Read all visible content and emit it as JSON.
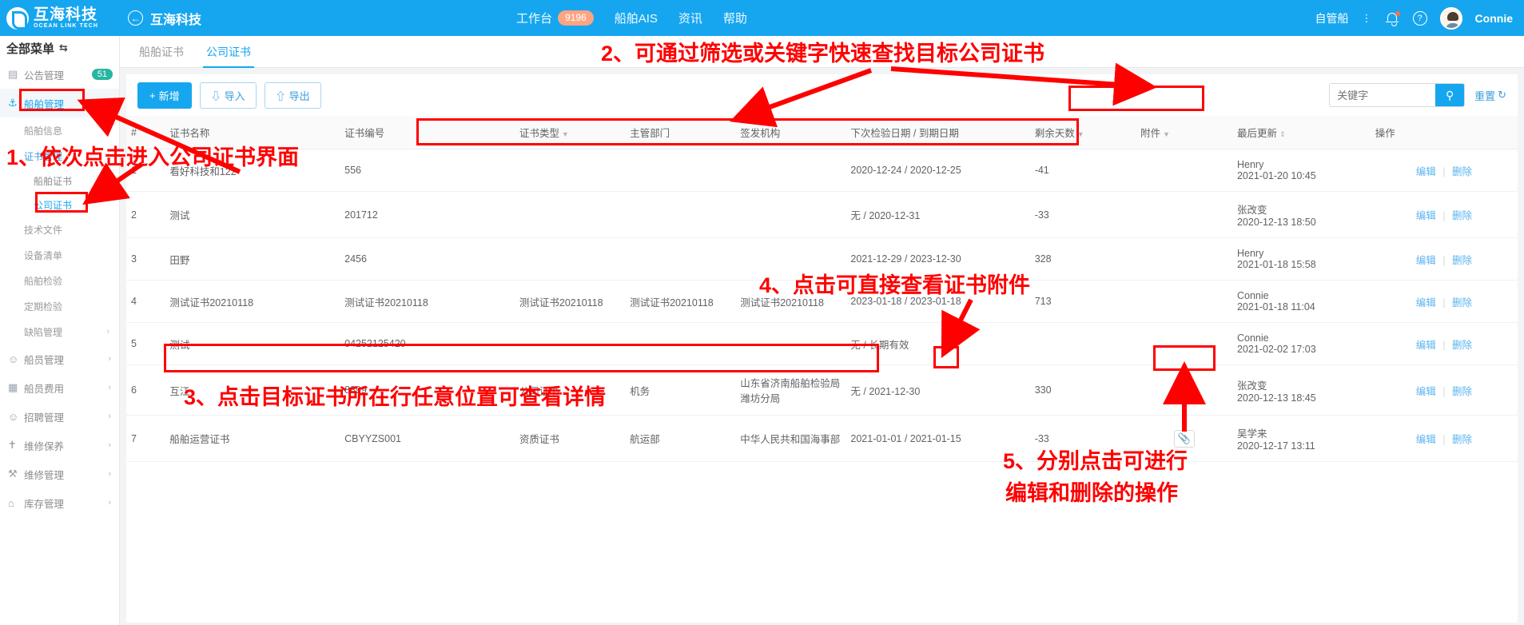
{
  "header": {
    "logo_cn": "互海科技",
    "logo_en": "OCEAN LINK TECH",
    "back_icon": "arrow-left-icon",
    "back_title": "互海科技",
    "nav": [
      {
        "label": "工作台",
        "badge": "9196"
      },
      {
        "label": "船舶AIS",
        "badge": ""
      },
      {
        "label": "资讯",
        "badge": ""
      },
      {
        "label": "帮助",
        "badge": ""
      }
    ],
    "vessel_scope": "自管船",
    "more_icon": "dots-vertical-icon",
    "bell_icon": "bell-icon",
    "help_icon": "question-circle-icon",
    "avatar_icon": "avatar-icon",
    "username": "Connie"
  },
  "sidebar": {
    "title": "全部菜单",
    "swap_icon": "swap-icon",
    "items": [
      {
        "label": "公告管理",
        "icon": "announcement-icon",
        "badge": "51",
        "level": "top"
      },
      {
        "label": "船舶管理",
        "icon": "anchor-icon",
        "badge": "",
        "level": "top",
        "active": true,
        "chevron": "chevron-down-icon"
      },
      {
        "label": "船舶信息",
        "level": "sub"
      },
      {
        "label": "证书管理",
        "level": "sub",
        "selected": true
      },
      {
        "label": "船舶证书",
        "level": "sub2"
      },
      {
        "label": "公司证书",
        "level": "sub2",
        "selected": true
      },
      {
        "label": "技术文件",
        "level": "sub"
      },
      {
        "label": "设备清单",
        "level": "sub"
      },
      {
        "label": "船舶检验",
        "level": "sub"
      },
      {
        "label": "定期检验",
        "level": "sub"
      },
      {
        "label": "缺陷管理",
        "level": "sub",
        "chevron": "chevron-right-icon"
      },
      {
        "label": "船员管理",
        "icon": "user-icon",
        "level": "top",
        "chevron": "chevron-right-icon"
      },
      {
        "label": "船员费用",
        "icon": "card-icon",
        "level": "top",
        "chevron": "chevron-right-icon"
      },
      {
        "label": "招聘管理",
        "icon": "user-plus-icon",
        "level": "top",
        "chevron": "chevron-right-icon"
      },
      {
        "label": "维修保养",
        "icon": "hammer-icon",
        "level": "top",
        "chevron": "chevron-right-icon"
      },
      {
        "label": "维修管理",
        "icon": "wrench-icon",
        "level": "top",
        "chevron": "chevron-right-icon"
      },
      {
        "label": "库存管理",
        "icon": "warehouse-icon",
        "level": "top",
        "chevron": "chevron-right-icon"
      }
    ]
  },
  "tabs": [
    {
      "label": "船舶证书",
      "active": false
    },
    {
      "label": "公司证书",
      "active": true
    }
  ],
  "toolbar": {
    "add_label": "新增",
    "add_icon": "plus-icon",
    "import_label": "导入",
    "import_icon": "download-icon",
    "export_label": "导出",
    "export_icon": "upload-icon",
    "search_placeholder": "关键字",
    "search_value": "",
    "search_icon": "search-icon",
    "reset_label": "重置",
    "reset_icon": "refresh-icon"
  },
  "table": {
    "columns": [
      {
        "key": "idx",
        "label": "#",
        "sort": ""
      },
      {
        "key": "name",
        "label": "证书名称",
        "sort": ""
      },
      {
        "key": "code",
        "label": "证书编号",
        "sort": ""
      },
      {
        "key": "type",
        "label": "证书类型",
        "sort": "filter"
      },
      {
        "key": "dept",
        "label": "主管部门",
        "sort": ""
      },
      {
        "key": "issuer",
        "label": "签发机构",
        "sort": ""
      },
      {
        "key": "dates",
        "label": "下次检验日期 / 到期日期",
        "sort": ""
      },
      {
        "key": "days",
        "label": "剩余天数",
        "sort": "filter"
      },
      {
        "key": "attach",
        "label": "附件",
        "sort": "filter"
      },
      {
        "key": "updated",
        "label": "最后更新",
        "sort": "both"
      },
      {
        "key": "ops",
        "label": "操作",
        "sort": ""
      }
    ],
    "rows": [
      {
        "idx": "1",
        "name": "看好科技和122",
        "code": "556",
        "type": "",
        "dept": "",
        "issuer": "",
        "dates": "2020-12-24 / 2020-12-25",
        "days": "-41",
        "days_negative": true,
        "attach": "",
        "updated_by": "Henry",
        "updated_at": "2021-01-20 10:45"
      },
      {
        "idx": "2",
        "name": "测试",
        "code": "201712",
        "type": "",
        "dept": "",
        "issuer": "",
        "dates": "无 / 2020-12-31",
        "days": "-33",
        "days_negative": true,
        "attach": "",
        "updated_by": "张改变",
        "updated_at": "2020-12-13 18:50"
      },
      {
        "idx": "3",
        "name": "田野",
        "code": "2456",
        "type": "",
        "dept": "",
        "issuer": "",
        "dates": "2021-12-29 / 2023-12-30",
        "days": "328",
        "days_negative": false,
        "attach": "",
        "updated_by": "Henry",
        "updated_at": "2021-01-18 15:58"
      },
      {
        "idx": "4",
        "name": "测试证书20210118",
        "code": "测试证书20210118",
        "type": "测试证书20210118",
        "dept": "测试证书20210118",
        "issuer": "测试证书20210118",
        "dates": "2023-01-18 / 2023-01-18",
        "days": "713",
        "days_negative": false,
        "attach": "",
        "updated_by": "Connie",
        "updated_at": "2021-01-18 11:04"
      },
      {
        "idx": "5",
        "name": "测试",
        "code": "04252125420",
        "type": "",
        "dept": "",
        "issuer": "",
        "dates": "无 / 长期有效",
        "days": "",
        "days_negative": false,
        "attach": "",
        "updated_by": "Connie",
        "updated_at": "2021-02-02 17:03"
      },
      {
        "idx": "6",
        "name": "互江",
        "code": "8899",
        "type": "公司证书",
        "dept": "机务",
        "issuer": "山东省济南船舶检验局潍坊分局",
        "dates": "无 / 2021-12-30",
        "days": "330",
        "days_negative": false,
        "attach": "",
        "updated_by": "张改变",
        "updated_at": "2020-12-13 18:45"
      },
      {
        "idx": "7",
        "name": "船舶运营证书",
        "code": "CBYYZS001",
        "type": "资质证书",
        "dept": "航运部",
        "issuer": "中华人民共和国海事部",
        "dates": "2021-01-01 / 2021-01-15",
        "days": "-33",
        "days_negative": true,
        "attach": "attachment-icon",
        "updated_by": "吴学来",
        "updated_at": "2020-12-17 13:11"
      }
    ],
    "ops": {
      "edit_label": "编辑",
      "delete_label": "删除",
      "separator": "|"
    }
  },
  "annotations": [
    {
      "id": "a1",
      "text": "1、依次点击进入公司证书界面"
    },
    {
      "id": "a2",
      "text": "2、可通过筛选或关键字快速查找目标公司证书"
    },
    {
      "id": "a3",
      "text": "3、点击目标证书所在行任意位置可查看详情"
    },
    {
      "id": "a4",
      "text": "4、点击可直接查看证书附件"
    },
    {
      "id": "a5_line1",
      "text": "5、分别点击可进行"
    },
    {
      "id": "a5_line2",
      "text": "编辑和删除的操作"
    }
  ],
  "colors": {
    "brand": "#16a6ef",
    "annotation": "#fe0000",
    "negative": "#ff6a33",
    "badge_green": "#27b6a0",
    "badge_orange": "#ffa483"
  }
}
